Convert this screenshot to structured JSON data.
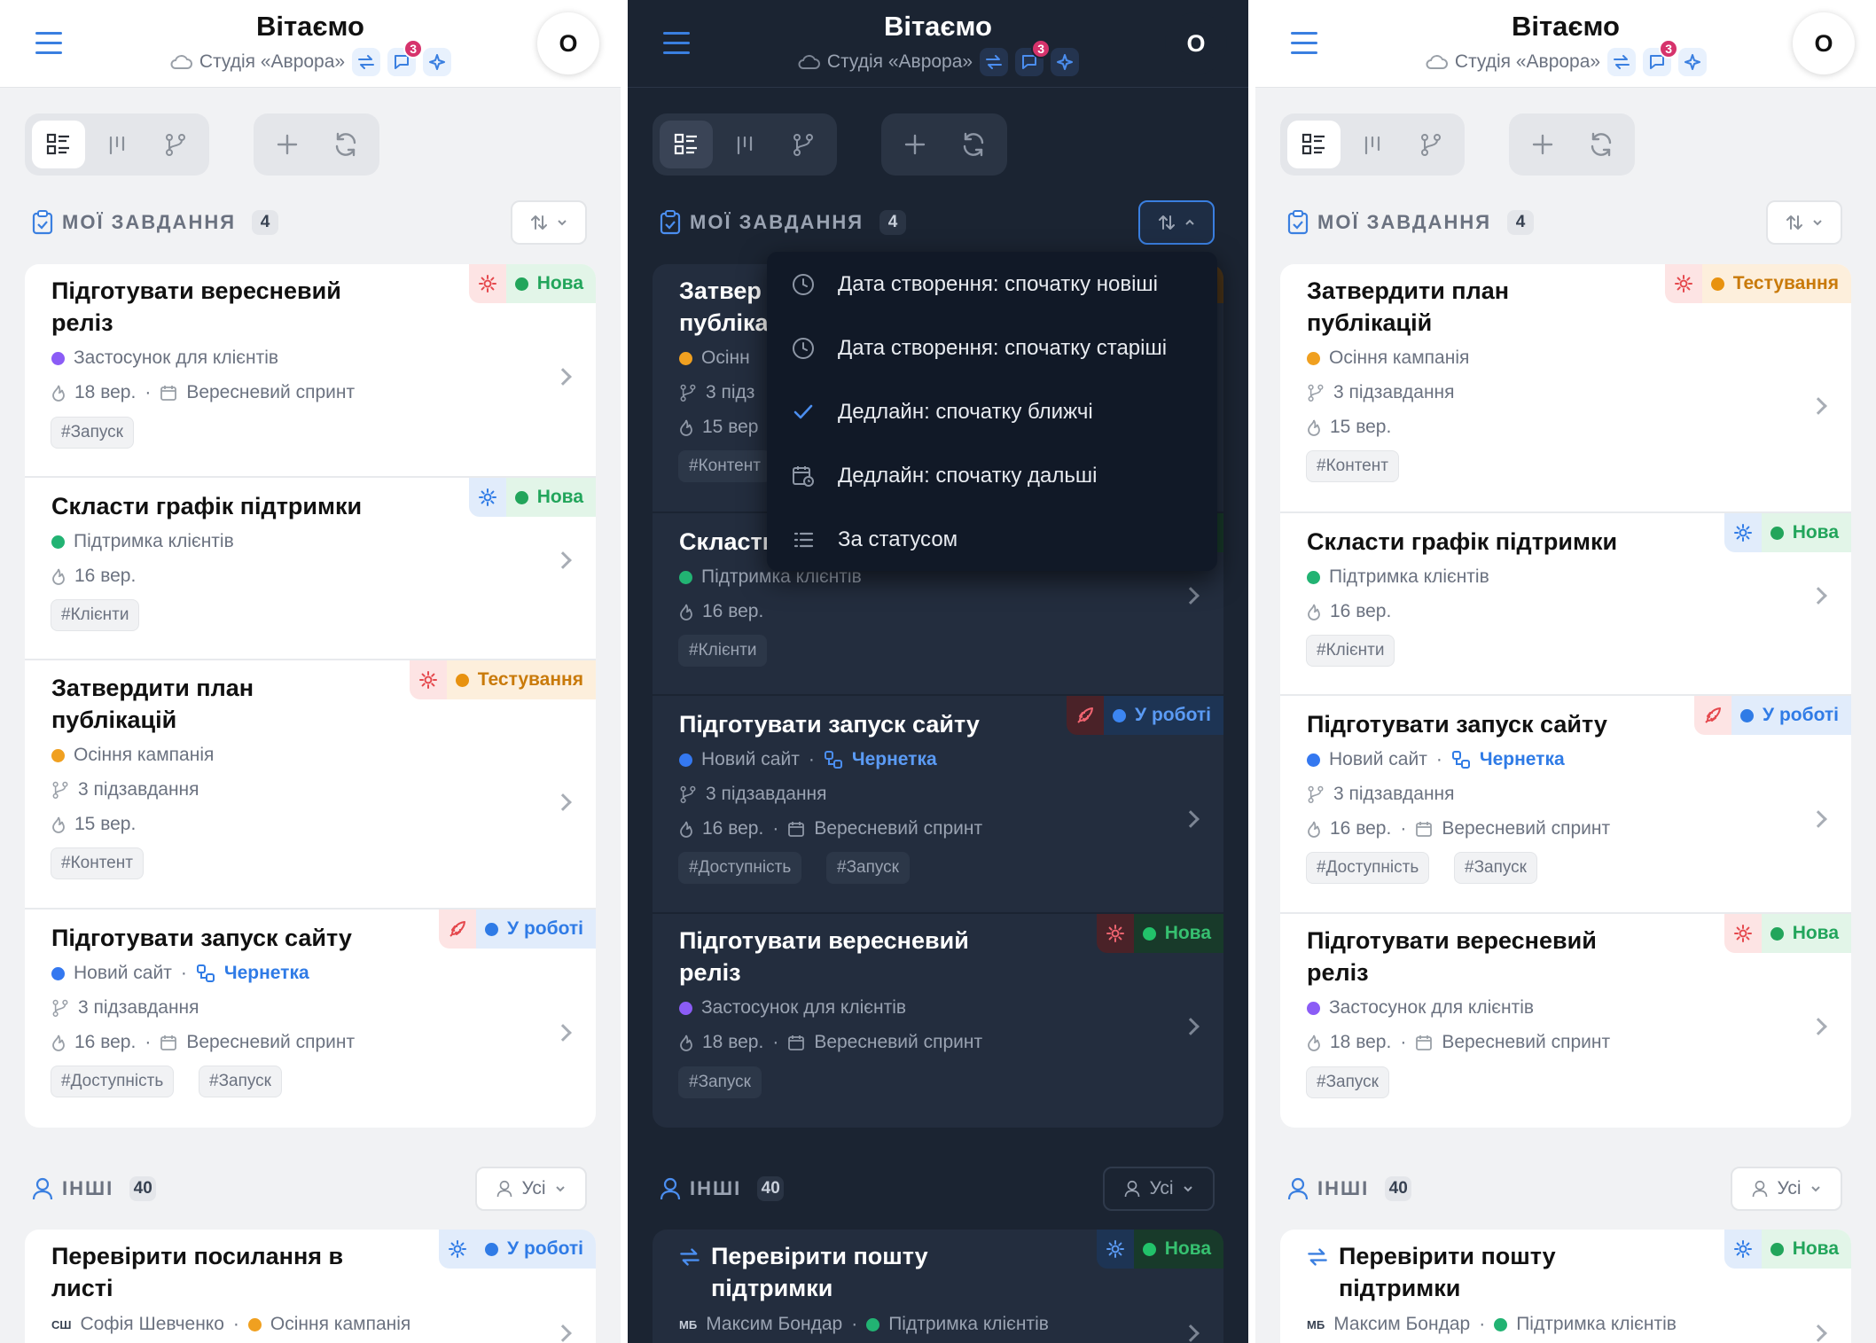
{
  "header": {
    "title": "Вітаємо",
    "studio": "Студія «Аврора»",
    "messages_badge": "3",
    "avatar_initial": "О"
  },
  "sections": {
    "mine_title": "МОЇ ЗАВДАННЯ",
    "mine_count": "4",
    "others_title": "ІНШІ",
    "others_count": "40",
    "filter_label": "Усі"
  },
  "status": {
    "new": "Нова",
    "testing": "Тестування",
    "in_progress": "У роботі"
  },
  "tasks": {
    "release": {
      "title_line1": "Підготувати вересневий",
      "title_line2": "реліз",
      "project": "Застосунок для клієнтів",
      "date": "18 вер.",
      "sprint": "Вересневий спринт",
      "tags": [
        "#Запуск"
      ]
    },
    "support": {
      "title": "Скласти графік підтримки",
      "project": "Підтримка клієнтів",
      "date": "16 вер.",
      "tags": [
        "#Клієнти"
      ]
    },
    "plan": {
      "title_line1": "Затвердити план",
      "title_line2": "публікацій",
      "project": "Осіння кампанія",
      "subtasks": "3 підзавдання",
      "date": "15 вер.",
      "tags": [
        "#Контент"
      ]
    },
    "site": {
      "title": "Підготувати запуск сайту",
      "project": "Новий сайт",
      "draft": "Чернетка",
      "subtasks": "3 підзавдання",
      "date": "16 вер.",
      "sprint": "Вересневий спринт",
      "tags": [
        "#Доступність",
        "#Запуск"
      ]
    }
  },
  "others": {
    "links": {
      "title_line1": "Перевірити посилання в",
      "title_line2": "листі",
      "initials": "СШ",
      "person": "Софія Шевченко",
      "project": "Осіння кампанія"
    },
    "mail": {
      "title_line1": "Перевірити пошту",
      "title_line2": "підтримки",
      "initials": "МБ",
      "person": "Максим Бондар",
      "project": "Підтримка клієнтів"
    }
  },
  "dark_partial": {
    "plan_title_line1": "Затвер",
    "plan_title_line2": "публіка",
    "plan_project": "Осінн",
    "plan_subtasks": "3 підз",
    "plan_date": "15 вер",
    "plan_tag": "#Контент",
    "support_title": "Скласти"
  },
  "sort_menu": {
    "items": [
      "Дата створення: спочатку новіші",
      "Дата створення: спочатку старіші",
      "Дедлайн: спочатку ближчі",
      "Дедлайн: спочатку дальші",
      "За статусом"
    ],
    "selected_index": 2
  },
  "colors": {
    "accent": "#3a7fe0",
    "new": "#22a55b",
    "testing": "#e8920f",
    "in_progress": "#2f7be6",
    "dot_purple": "#8b5cf6",
    "dot_green": "#22b373",
    "dot_orange": "#f0a020",
    "dot_blue": "#3478f0"
  }
}
